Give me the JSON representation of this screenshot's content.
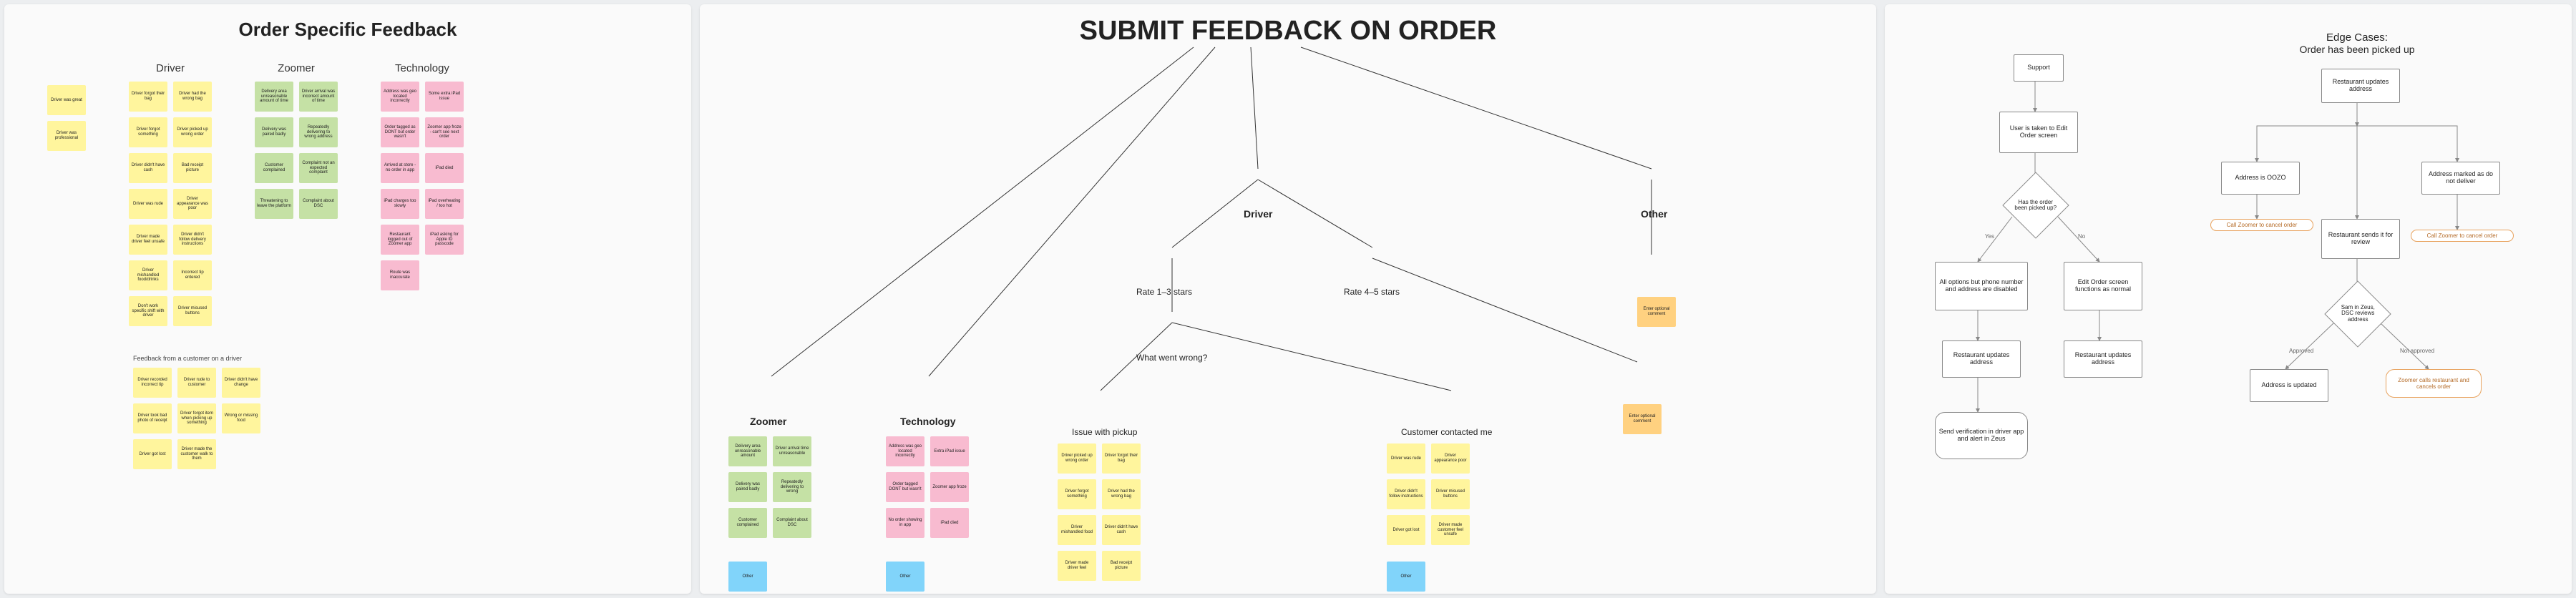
{
  "left": {
    "title": "Order Specific Feedback",
    "cols": [
      "Driver",
      "Zoomer",
      "Technology"
    ],
    "side_notes": [
      "Driver was great",
      "Driver was professional"
    ],
    "driver": [
      "Driver forgot their bag",
      "Driver had the wrong bag",
      "Driver forgot something",
      "Driver picked up wrong order",
      "Driver didn't have cash",
      "Bad receipt picture",
      "Driver was rude",
      "Driver appearance was poor",
      "Driver made driver feel unsafe",
      "Driver didn't follow delivery instructions",
      "Driver mishandled food/drinks",
      "Incorrect tip entered",
      "Don't work specific shift with driver",
      "Driver misused buttons"
    ],
    "zoomer": [
      "Delivery area unreasonable amount of time",
      "Driver arrival was incorrect amount of time",
      "Delivery was paired badly",
      "Repeatedly delivering to wrong address",
      "Customer complained",
      "Complaint not an expected complaint",
      "Threatening to leave the platform",
      "Complaint about DSC"
    ],
    "tech": [
      "Address was geo located incorrectly",
      "Some extra iPad issue",
      "Order tagged as DONT but order wasn't",
      "Zoomer app froze - can't see next order",
      "Arrived at store - no order in app",
      "iPad died",
      "iPad charges too slowly",
      "iPad overheating / too hot",
      "Restaurant logged out of Zoomer app",
      "iPad asking for Apple ID passcode",
      "Route was inaccurate",
      ""
    ],
    "footer_label": "Feedback from a customer on a driver",
    "footer": [
      "Driver recorded incorrect tip",
      "Driver rude to customer",
      "Driver didn't have change",
      "Driver took bad photo of receipt",
      "Driver forgot item when picking up something",
      "Wrong or missing food",
      "Driver got lost",
      "Driver made the customer walk to them",
      ""
    ]
  },
  "mid": {
    "title": "SUBMIT FEEDBACK ON ORDER",
    "nodes": {
      "driver": "Driver",
      "other": "Other",
      "rate13": "Rate 1–3 stars",
      "rate45": "Rate 4–5 stars",
      "whatwrong": "What went wrong?",
      "zoomer": "Zoomer",
      "tech": "Technology",
      "pickup": "Issue with pickup",
      "contacted": "Customer contacted me",
      "note_other": "Enter optional comment",
      "note_driver": "Enter optional comment",
      "other_btn": "Other"
    },
    "zoomer_notes": [
      "Delivery area unreasonable amount",
      "Driver arrival time unreasonable",
      "Delivery was paired badly",
      "Repeatedly delivering to wrong",
      "Customer complained",
      "Complaint about DSC"
    ],
    "tech_notes": [
      "Address was geo located incorrectly",
      "Extra iPad issue",
      "Order tagged DONT but wasn't",
      "Zoomer app froze",
      "No order showing in app",
      "iPad died"
    ],
    "pickup_notes": [
      "Driver picked up wrong order",
      "Driver forgot their bag",
      "Driver forgot something",
      "Driver had the wrong bag",
      "Driver mishandled food",
      "Driver didn't have cash",
      "Driver made driver feel",
      "Bad receipt picture"
    ],
    "contacted_notes": [
      "Driver was rude",
      "Driver appearance poor",
      "Driver didn't follow instructions",
      "Driver misused buttons",
      "Driver got lost",
      "Driver made customer feel unsafe"
    ]
  },
  "right": {
    "titleA": "",
    "titleB_1": "Edge Cases:",
    "titleB_2": "Order has been picked up",
    "A": {
      "support": "Support",
      "taken": "User is taken to Edit Order screen",
      "picked": "Has the order been picked up?",
      "yes": "Yes",
      "no": "No",
      "disabled": "All options but phone number and address are disabled",
      "editnormal": "Edit Order screen functions as normal",
      "rest_update1": "Restaurant updates address",
      "rest_update2": "Restaurant updates address",
      "send": "Send verification in driver app and alert in Zeus"
    },
    "B": {
      "start": "Restaurant updates address",
      "oozo": "Address is OOZO",
      "nodeliver": "Address marked as do not deliver",
      "call1": "Call Zoomer to cancel order",
      "call2": "Call Zoomer to cancel order",
      "review": "Restaurant sends it for review",
      "zeus": "Sam in Zeus, DSC reviews address",
      "approved": "Approved",
      "notapproved": "Not approved",
      "updated": "Address is updated",
      "zcalls": "Zoomer calls restaurant and cancels order"
    }
  }
}
